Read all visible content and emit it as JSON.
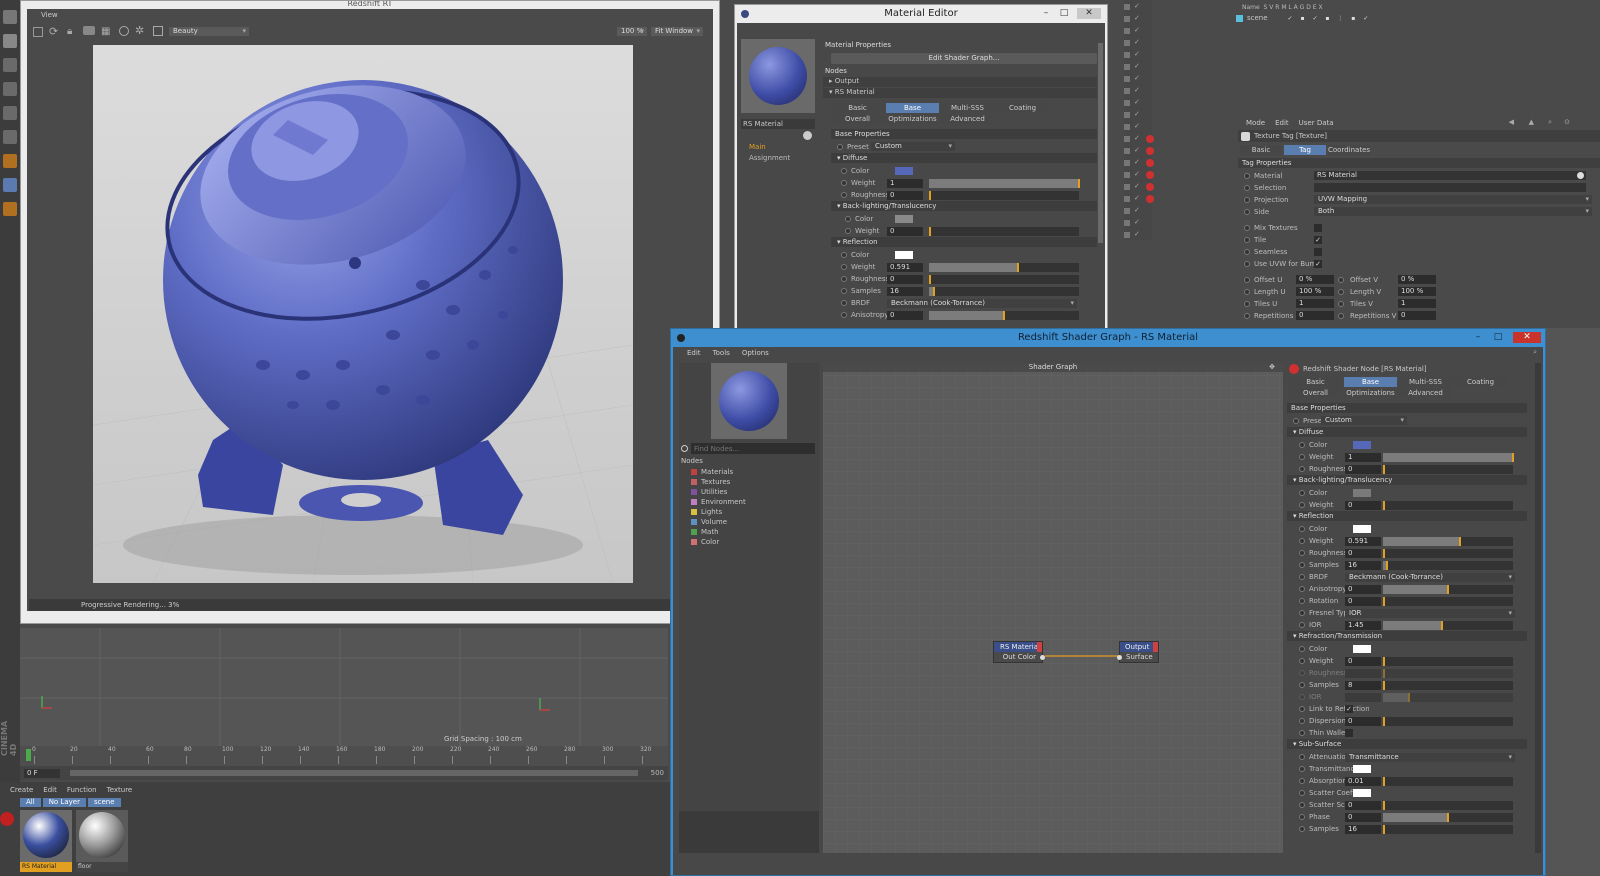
{
  "viewer": {
    "title": "Redshift RT",
    "menu_view": "View",
    "aov_select": "Beauty",
    "zoom": "100 %",
    "fit": "Fit Window",
    "status": "Progressive Rendering... 3%"
  },
  "viewport": {
    "grid_spacing": "Grid Spacing : 100 cm",
    "timeline_ticks": [
      "0",
      "20",
      "40",
      "60",
      "80",
      "100",
      "120",
      "140",
      "160",
      "180",
      "200",
      "220",
      "240",
      "260",
      "280",
      "300",
      "320"
    ],
    "frame_start": "0 F",
    "frame_end": "500",
    "brand": "CINEMA 4D"
  },
  "material_manager": {
    "menu": [
      "Create",
      "Edit",
      "Function",
      "Texture"
    ],
    "filters": [
      "All",
      "No Layer",
      "scene"
    ],
    "materials": [
      {
        "name": "RS Material",
        "color": "#3a4fa0",
        "selected": true
      },
      {
        "name": "floor",
        "color": "#9a9a9a",
        "selected": false
      }
    ]
  },
  "material_editor": {
    "title": "Material Editor",
    "preview_name": "RS Material",
    "side_links": [
      "Main",
      "Assignment"
    ],
    "header": "Material Properties",
    "edit_button": "Edit Shader Graph...",
    "nodes_label": "Nodes",
    "tree": [
      "Output",
      "RS Material"
    ],
    "tabs_row1": [
      "Basic",
      "Base Properties",
      "Multi-SSS",
      "Coating"
    ],
    "tabs_row2": [
      "Overall",
      "Optimizations",
      "Advanced"
    ],
    "base_properties": "Base Properties",
    "preset_label": "Preset",
    "preset_value": "Custom",
    "diffuse": "Diffuse",
    "diffuse_rows": [
      {
        "label": "Color",
        "type": "color",
        "color": "#5668b8"
      },
      {
        "label": "Weight",
        "value": "1",
        "fill": 1.0
      },
      {
        "label": "Roughness",
        "value": "0",
        "fill": 0.0
      }
    ],
    "backlight": "Back-lighting/Translucency",
    "backlight_rows": [
      {
        "label": "Color",
        "type": "color",
        "color": "#8a8a8a"
      },
      {
        "label": "Weight",
        "value": "0",
        "fill": 0.0
      }
    ],
    "reflection": "Reflection",
    "reflection_rows": [
      {
        "label": "Color",
        "type": "color",
        "color": "#ffffff"
      },
      {
        "label": "Weight",
        "value": "0.591",
        "fill": 0.59
      },
      {
        "label": "Roughness",
        "value": "0",
        "fill": 0.0
      },
      {
        "label": "Samples",
        "value": "16",
        "fill": 0.03
      },
      {
        "label": "BRDF",
        "type": "dropdown",
        "value": "Beckmann (Cook-Torrance)"
      },
      {
        "label": "Anisotropy",
        "value": "0",
        "fill": 0.5
      }
    ]
  },
  "object_manager": {
    "columns": "Name  S V R M L A G D E X",
    "scene": "scene"
  },
  "attributes": {
    "menu": [
      "Mode",
      "Edit",
      "User Data"
    ],
    "tag_title": "Texture Tag [Texture]",
    "tabs": [
      "Basic",
      "Tag",
      "Coordinates"
    ],
    "section": "Tag Properties",
    "material_label": "Material",
    "material_value": "RS Material",
    "selection_label": "Selection",
    "projection_label": "Projection",
    "projection_value": "UVW Mapping",
    "side_label": "Side",
    "side_value": "Both",
    "checks": [
      {
        "label": "Mix Textures",
        "checked": false
      },
      {
        "label": "Tile",
        "checked": true
      },
      {
        "label": "Seamless",
        "checked": false
      },
      {
        "label": "Use UVW for Bump",
        "checked": true
      }
    ],
    "pairs": [
      [
        "Offset U",
        "0 %",
        "Offset V",
        "0 %"
      ],
      [
        "Length U",
        "100 %",
        "Length V",
        "100 %"
      ],
      [
        "Tiles U",
        "1",
        "Tiles V",
        "1"
      ],
      [
        "Repetitions U",
        "0",
        "Repetitions V",
        "0"
      ]
    ]
  },
  "shader_graph": {
    "title": "Redshift Shader Graph - RS Material",
    "menu": [
      "Edit",
      "Tools",
      "Options"
    ],
    "canvas_title": "Shader Graph",
    "find_placeholder": "Find Nodes...",
    "nodes_label": "Nodes",
    "categories": [
      {
        "name": "Materials",
        "color": "#c04040"
      },
      {
        "name": "Textures",
        "color": "#c06060"
      },
      {
        "name": "Utilities",
        "color": "#8050a0"
      },
      {
        "name": "Environment",
        "color": "#c080c0"
      },
      {
        "name": "Lights",
        "color": "#d8c040"
      },
      {
        "name": "Volume",
        "color": "#6090c0"
      },
      {
        "name": "Math",
        "color": "#50a050"
      },
      {
        "name": "Color",
        "color": "#d07070"
      }
    ],
    "node_material": {
      "title": "RS Material",
      "port": "Out Color"
    },
    "node_output": {
      "title": "Output",
      "port": "Surface"
    }
  },
  "node_properties": {
    "title": "Redshift Shader Node [RS Material]",
    "tabs_row1": [
      "Basic",
      "Base Properties",
      "Multi-SSS",
      "Coating"
    ],
    "tabs_row2": [
      "Overall",
      "Optimizations",
      "Advanced"
    ],
    "base_properties": "Base Properties",
    "preset_label": "Preset",
    "preset_value": "Custom",
    "sections": [
      {
        "name": "Diffuse",
        "rows": [
          {
            "label": "Color",
            "type": "color",
            "color": "#5668b8"
          },
          {
            "label": "Weight",
            "value": "1",
            "fill": 1.0
          },
          {
            "label": "Roughness",
            "value": "0",
            "fill": 0.0
          }
        ]
      },
      {
        "name": "Back-lighting/Translucency",
        "rows": [
          {
            "label": "Color",
            "type": "color",
            "color": "#7a7a7a"
          },
          {
            "label": "Weight",
            "value": "0",
            "fill": 0.0
          }
        ]
      },
      {
        "name": "Reflection",
        "rows": [
          {
            "label": "Color",
            "type": "color",
            "color": "#ffffff"
          },
          {
            "label": "Weight",
            "value": "0.591",
            "fill": 0.59
          },
          {
            "label": "Roughness",
            "value": "0",
            "fill": 0.0
          },
          {
            "label": "Samples",
            "value": "16",
            "fill": 0.03
          },
          {
            "label": "BRDF",
            "type": "dropdown",
            "value": "Beckmann (Cook-Torrance)"
          },
          {
            "label": "Anisotropy",
            "value": "0",
            "fill": 0.5
          },
          {
            "label": "Rotation",
            "value": "0",
            "fill": 0.0
          },
          {
            "label": "Fresnel Type",
            "type": "dropdown",
            "value": "IOR"
          },
          {
            "label": "IOR",
            "value": "1.45",
            "fill": 0.45
          }
        ]
      },
      {
        "name": "Refraction/Transmission",
        "rows": [
          {
            "label": "Color",
            "type": "color",
            "color": "#ffffff"
          },
          {
            "label": "Weight",
            "value": "0",
            "fill": 0.0
          },
          {
            "label": "Roughness",
            "value": "",
            "fill": 0.0,
            "disabled": true
          },
          {
            "label": "Samples",
            "value": "8",
            "fill": 0.0
          },
          {
            "label": "IOR",
            "value": "",
            "fill": 0.2,
            "disabled": true
          },
          {
            "label": "Link to Reflection",
            "type": "check",
            "checked": true
          },
          {
            "label": "Dispersion",
            "value": "0",
            "fill": 0.0
          },
          {
            "label": "Thin Walled",
            "type": "check",
            "checked": false
          }
        ]
      },
      {
        "name": "Sub-Surface",
        "rows": [
          {
            "label": "Attenuation Units",
            "type": "dropdown",
            "value": "Transmittance"
          },
          {
            "label": "Transmittance Color",
            "type": "color",
            "color": "#ffffff"
          },
          {
            "label": "Absorption Scale",
            "value": "0.01",
            "fill": 0.0
          },
          {
            "label": "Scatter Coeff",
            "type": "color",
            "color": "#ffffff"
          },
          {
            "label": "Scatter Scale",
            "value": "0",
            "fill": 0.0
          },
          {
            "label": "Phase",
            "value": "0",
            "fill": 0.5
          },
          {
            "label": "Samples",
            "value": "16",
            "fill": 0.0
          }
        ]
      }
    ]
  }
}
